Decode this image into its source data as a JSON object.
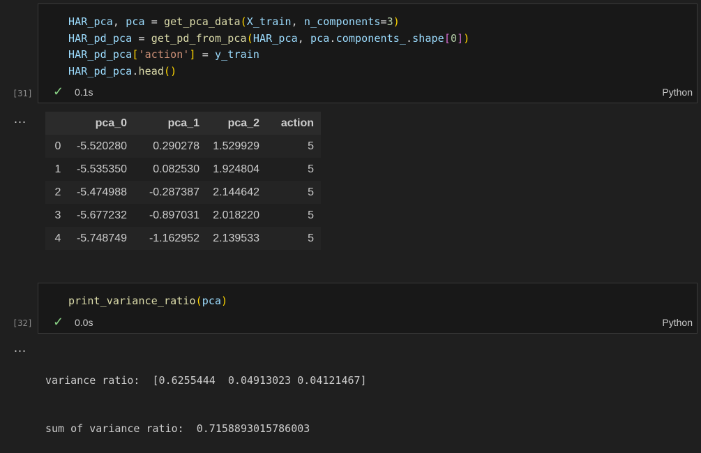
{
  "cell1": {
    "exec_count": "[31]",
    "lines": [
      [
        [
          "v",
          "HAR_pca"
        ],
        [
          "p",
          ", "
        ],
        [
          "v",
          "pca"
        ],
        [
          "p",
          " = "
        ],
        [
          "f",
          "get_pca_data"
        ],
        [
          "b1",
          "("
        ],
        [
          "v",
          "X_train"
        ],
        [
          "p",
          ", "
        ],
        [
          "v",
          "n_components"
        ],
        [
          "p",
          "="
        ],
        [
          "n",
          "3"
        ],
        [
          "b1",
          ")"
        ]
      ],
      [
        [
          "v",
          "HAR_pd_pca"
        ],
        [
          "p",
          " = "
        ],
        [
          "f",
          "get_pd_from_pca"
        ],
        [
          "b1",
          "("
        ],
        [
          "v",
          "HAR_pca"
        ],
        [
          "p",
          ", "
        ],
        [
          "v",
          "pca"
        ],
        [
          "p",
          "."
        ],
        [
          "v",
          "components_"
        ],
        [
          "p",
          "."
        ],
        [
          "v",
          "shape"
        ],
        [
          "b2",
          "["
        ],
        [
          "n",
          "0"
        ],
        [
          "b2",
          "]"
        ],
        [
          "b1",
          ")"
        ]
      ],
      [
        [
          "v",
          "HAR_pd_pca"
        ],
        [
          "b1",
          "["
        ],
        [
          "s",
          "'action'"
        ],
        [
          "b1",
          "]"
        ],
        [
          "p",
          " = "
        ],
        [
          "v",
          "y_train"
        ]
      ],
      [
        [
          "v",
          "HAR_pd_pca"
        ],
        [
          "p",
          "."
        ],
        [
          "f",
          "head"
        ],
        [
          "b1",
          "()"
        ]
      ]
    ],
    "time": "0.1s",
    "language": "Python"
  },
  "output1": {
    "ellipsis": "...",
    "table": {
      "columns": [
        "",
        "pca_0",
        "pca_1",
        "pca_2",
        "action"
      ],
      "rows": [
        [
          "0",
          "-5.520280",
          "0.290278",
          "1.529929",
          "5"
        ],
        [
          "1",
          "-5.535350",
          "0.082530",
          "1.924804",
          "5"
        ],
        [
          "2",
          "-5.474988",
          "-0.287387",
          "2.144642",
          "5"
        ],
        [
          "3",
          "-5.677232",
          "-0.897031",
          "2.018220",
          "5"
        ],
        [
          "4",
          "-5.748749",
          "-1.162952",
          "2.139533",
          "5"
        ]
      ]
    }
  },
  "cell2": {
    "exec_count": "[32]",
    "lines": [
      [
        [
          "f",
          "print_variance_ratio"
        ],
        [
          "b1",
          "("
        ],
        [
          "v",
          "pca"
        ],
        [
          "b1",
          ")"
        ]
      ]
    ],
    "time": "0.0s",
    "language": "Python"
  },
  "output2": {
    "ellipsis": "...",
    "text_lines": [
      "variance ratio:  [0.6255444  0.04913023 0.04121467]",
      "sum of variance ratio:  0.7158893015786003"
    ]
  },
  "colors": {
    "background": "#1f1f1f",
    "cell_background": "#181818",
    "success_check": "#89d185",
    "variable": "#9cdcfe",
    "function": "#dcdcaa",
    "number": "#b5cea8",
    "string": "#ce9178"
  },
  "icons": {
    "success": "check-icon",
    "more": "ellipsis-icon"
  }
}
